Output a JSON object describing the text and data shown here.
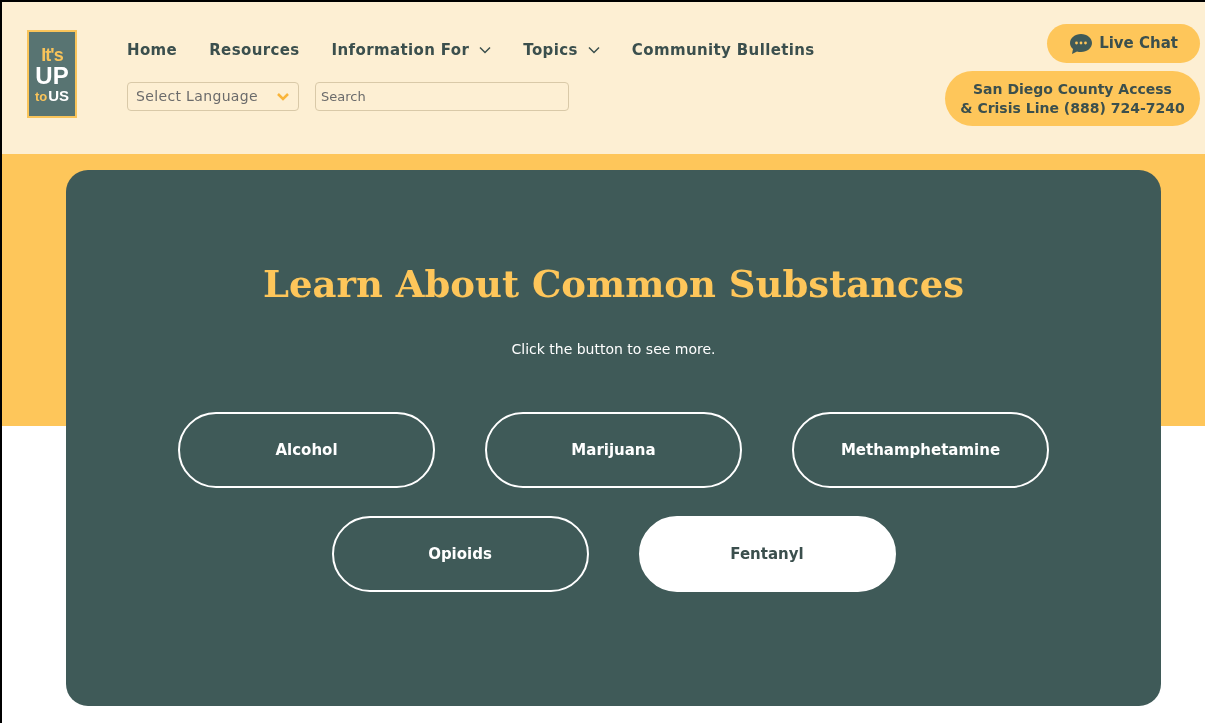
{
  "logo": {
    "line_1": "It's",
    "line_2": "UP",
    "line_3": "to",
    "line_4": "US"
  },
  "nav": [
    {
      "label": "Home",
      "dropdown": false
    },
    {
      "label": "Resources",
      "dropdown": false
    },
    {
      "label": "Information For",
      "dropdown": true
    },
    {
      "label": "Topics",
      "dropdown": true
    },
    {
      "label": "Community Bulletins",
      "dropdown": false
    }
  ],
  "language_select": {
    "value": "Select Language"
  },
  "search": {
    "placeholder": "Search"
  },
  "live_chat": {
    "label": "Live Chat"
  },
  "crisis_line": {
    "line_1": "San Diego County Access",
    "line_2": "& Crisis Line (888) 724-7240"
  },
  "hero": {
    "title": "Learn About Common Substances",
    "subtitle": "Click the button to see more.",
    "buttons": [
      {
        "label": "Alcohol",
        "selected": false
      },
      {
        "label": "Marijuana",
        "selected": false
      },
      {
        "label": "Methamphetamine",
        "selected": false
      },
      {
        "label": "Opioids",
        "selected": false
      },
      {
        "label": "Fentanyl",
        "selected": true
      }
    ]
  }
}
